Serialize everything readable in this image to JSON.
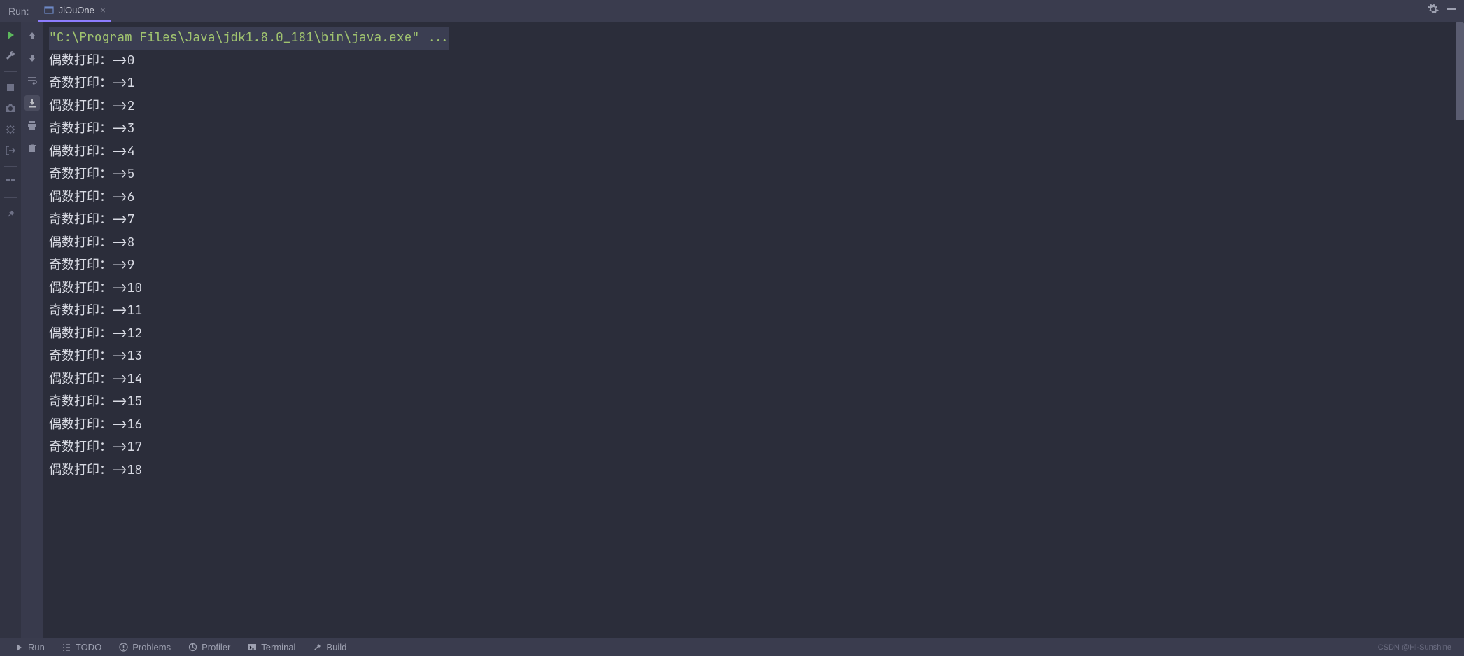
{
  "header": {
    "run_label": "Run:",
    "tab_name": "JiOuOne"
  },
  "console": {
    "command": "\"C:\\Program Files\\Java\\jdk1.8.0_181\\bin\\java.exe\" ...",
    "lines": [
      "偶数打印：->0",
      "奇数打印：->1",
      "偶数打印：->2",
      "奇数打印：->3",
      "偶数打印：->4",
      "奇数打印：->5",
      "偶数打印：->6",
      "奇数打印：->7",
      "偶数打印：->8",
      "奇数打印：->9",
      "偶数打印：->10",
      "奇数打印：->11",
      "偶数打印：->12",
      "奇数打印：->13",
      "偶数打印：->14",
      "奇数打印：->15",
      "偶数打印：->16",
      "奇数打印：->17",
      "偶数打印：->18"
    ]
  },
  "bottom": {
    "run": "Run",
    "todo": "TODO",
    "problems": "Problems",
    "profiler": "Profiler",
    "terminal": "Terminal",
    "build": "Build",
    "watermark": "CSDN @Hi-Sunshine"
  }
}
